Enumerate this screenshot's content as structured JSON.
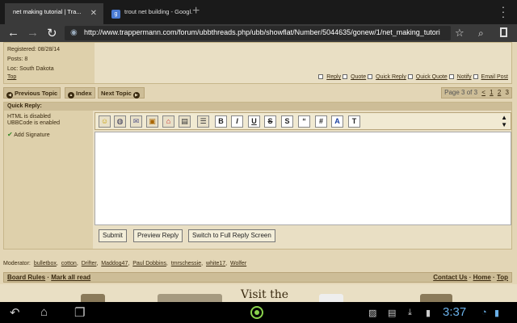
{
  "browser": {
    "tabs": [
      {
        "title": "net making tutorial | Tra...",
        "active": true
      },
      {
        "title": "trout net building - Googl...",
        "active": false
      }
    ],
    "url": "http://www.trappermann.com/forum/ubbthreads.php/ubb/showflat/Number/5044635/gonew/1/net_making_tutori"
  },
  "post": {
    "registered": "Registered: 08/28/14",
    "posts": "Posts: 8",
    "loc": "Loc: South Dakota",
    "top_link": "Top",
    "actions": [
      "Reply",
      "Quote",
      "Quick Reply",
      "Quick Quote",
      "Notify",
      "Email Post"
    ]
  },
  "nav": {
    "prev": "Previous Topic",
    "index": "Index",
    "next": "Next Topic",
    "page_label": "Page 3 of 3",
    "pages": [
      "<",
      "1",
      "2",
      "3"
    ]
  },
  "quick_reply": {
    "header": "Quick Reply:",
    "html_status": "HTML is disabled",
    "ubb_status": "UBBCode is enabled",
    "signature": "Add Signature",
    "format_buttons": [
      "B",
      "I",
      "U",
      "S",
      "S",
      "“",
      "#",
      "A",
      "T"
    ],
    "submit": "Submit",
    "preview": "Preview Reply",
    "full": "Switch to Full Reply Screen"
  },
  "moderators": {
    "label": "Moderator:",
    "names": [
      "bulletbox",
      "cotton",
      "Drifter",
      "Maddog47",
      "Paul Dobbins",
      "tmrschessie",
      "white17",
      "Wolfer"
    ]
  },
  "footer": {
    "board_rules": "Board Rules",
    "mark_all": "Mark all read",
    "contact": "Contact Us",
    "home": "Home",
    "top": "Top",
    "banner_text": "Visit the"
  },
  "system": {
    "clock": "3:37"
  }
}
